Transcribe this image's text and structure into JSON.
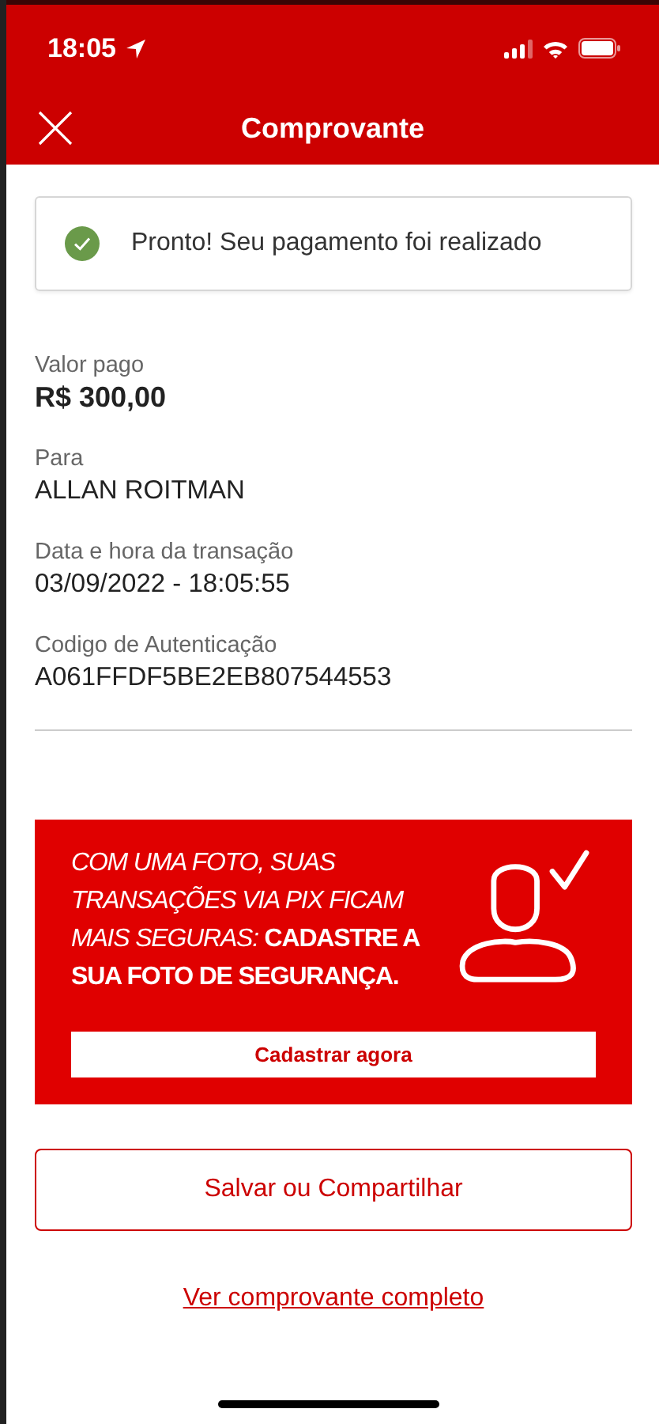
{
  "status_bar": {
    "time": "18:05"
  },
  "header": {
    "title": "Comprovante"
  },
  "success_message": {
    "text": "Pronto! Seu pagamento foi realizado"
  },
  "fields": [
    {
      "label": "Valor pago",
      "value": "R$ 300,00",
      "kind": "amount"
    },
    {
      "label": "Para",
      "value": "ALLAN ROITMAN",
      "kind": "plain"
    },
    {
      "label": "Data e hora da transação",
      "value": "03/09/2022 - 18:05:55",
      "kind": "plain"
    },
    {
      "label": "Codigo de Autenticação",
      "value": "A061FFDF5BE2EB807544553",
      "kind": "plain"
    }
  ],
  "banner": {
    "text": "COM UMA FOTO, SUAS TRANSAÇÕES VIA PIX FICAM MAIS SEGURAS: **CADASTRE A SUA FOTO DE SEGURANÇA.**",
    "button": "Cadastrar agora"
  },
  "share_button": "Salvar ou Compartilhar",
  "full_receipt_link": "Ver comprovante completo"
}
